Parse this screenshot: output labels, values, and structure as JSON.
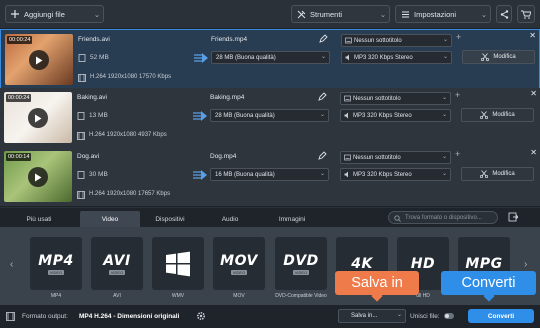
{
  "toolbar": {
    "add_files": "Aggiungi file",
    "tools": "Strumenti",
    "settings": "Impostazioni"
  },
  "files": [
    {
      "timecode": "00:00:24",
      "name": "Friends.avi",
      "size": "52 MB",
      "meta": "H.264 1920x1080 17570 Kbps",
      "output_name": "Friends.mp4",
      "output_size": "28 MB (Buona qualità)",
      "subtitle": "Nessun sottotitolo",
      "audio": "MP3 320 Kbps Stereo",
      "edit_label": "Modifica",
      "selected": true
    },
    {
      "timecode": "00:00:24",
      "name": "Baking.avi",
      "size": "13 MB",
      "meta": "H.264 1920x1080 4937 Kbps",
      "output_name": "Baking.mp4",
      "output_size": "28 MB (Buona qualità)",
      "subtitle": "Nessun sottotitolo",
      "audio": "MP3 320 Kbps Stereo",
      "edit_label": "Modifica",
      "selected": false
    },
    {
      "timecode": "00:00:14",
      "name": "Dog.avi",
      "size": "30 MB",
      "meta": "H.264 1920x1080 17657 Kbps",
      "output_name": "Dog.mp4",
      "output_size": "16 MB (Buona qualità)",
      "subtitle": "Nessun sottotitolo",
      "audio": "MP3 320 Kbps Stereo",
      "edit_label": "Modifica",
      "selected": false
    }
  ],
  "tabs": [
    "Più usati",
    "Video",
    "Dispositivi",
    "Audio",
    "Immagini"
  ],
  "active_tab": "Video",
  "search_placeholder": "Trova formato o dispositivo...",
  "formats": [
    {
      "big": "MP4",
      "sub": "VIDEO",
      "label": "MP4"
    },
    {
      "big": "AVI",
      "sub": "VIDEO",
      "label": "AVI"
    },
    {
      "big": "",
      "sub": "",
      "label": "WMV"
    },
    {
      "big": "MOV",
      "sub": "VIDEO",
      "label": "MOV"
    },
    {
      "big": "DVD",
      "sub": "VIDEO",
      "label": "DVD-Compatible Video"
    },
    {
      "big": "4K",
      "sub": "",
      "label": ""
    },
    {
      "big": "HD",
      "sub": "",
      "label": "ull HD"
    },
    {
      "big": "MPG",
      "sub": "",
      "label": ""
    }
  ],
  "callouts": {
    "save": "Salva in",
    "convert": "Converti"
  },
  "bottom": {
    "output_format_label": "Formato output:",
    "output_format_value": "MP4 H.264 - Dimensioni originali",
    "save_in": "Salva in...",
    "merge_files": "Unisci file:",
    "convert": "Converti"
  },
  "colors": {
    "accent": "#2f8ee8",
    "callout": "#f07b4a",
    "selected_border": "#3a8be0"
  }
}
